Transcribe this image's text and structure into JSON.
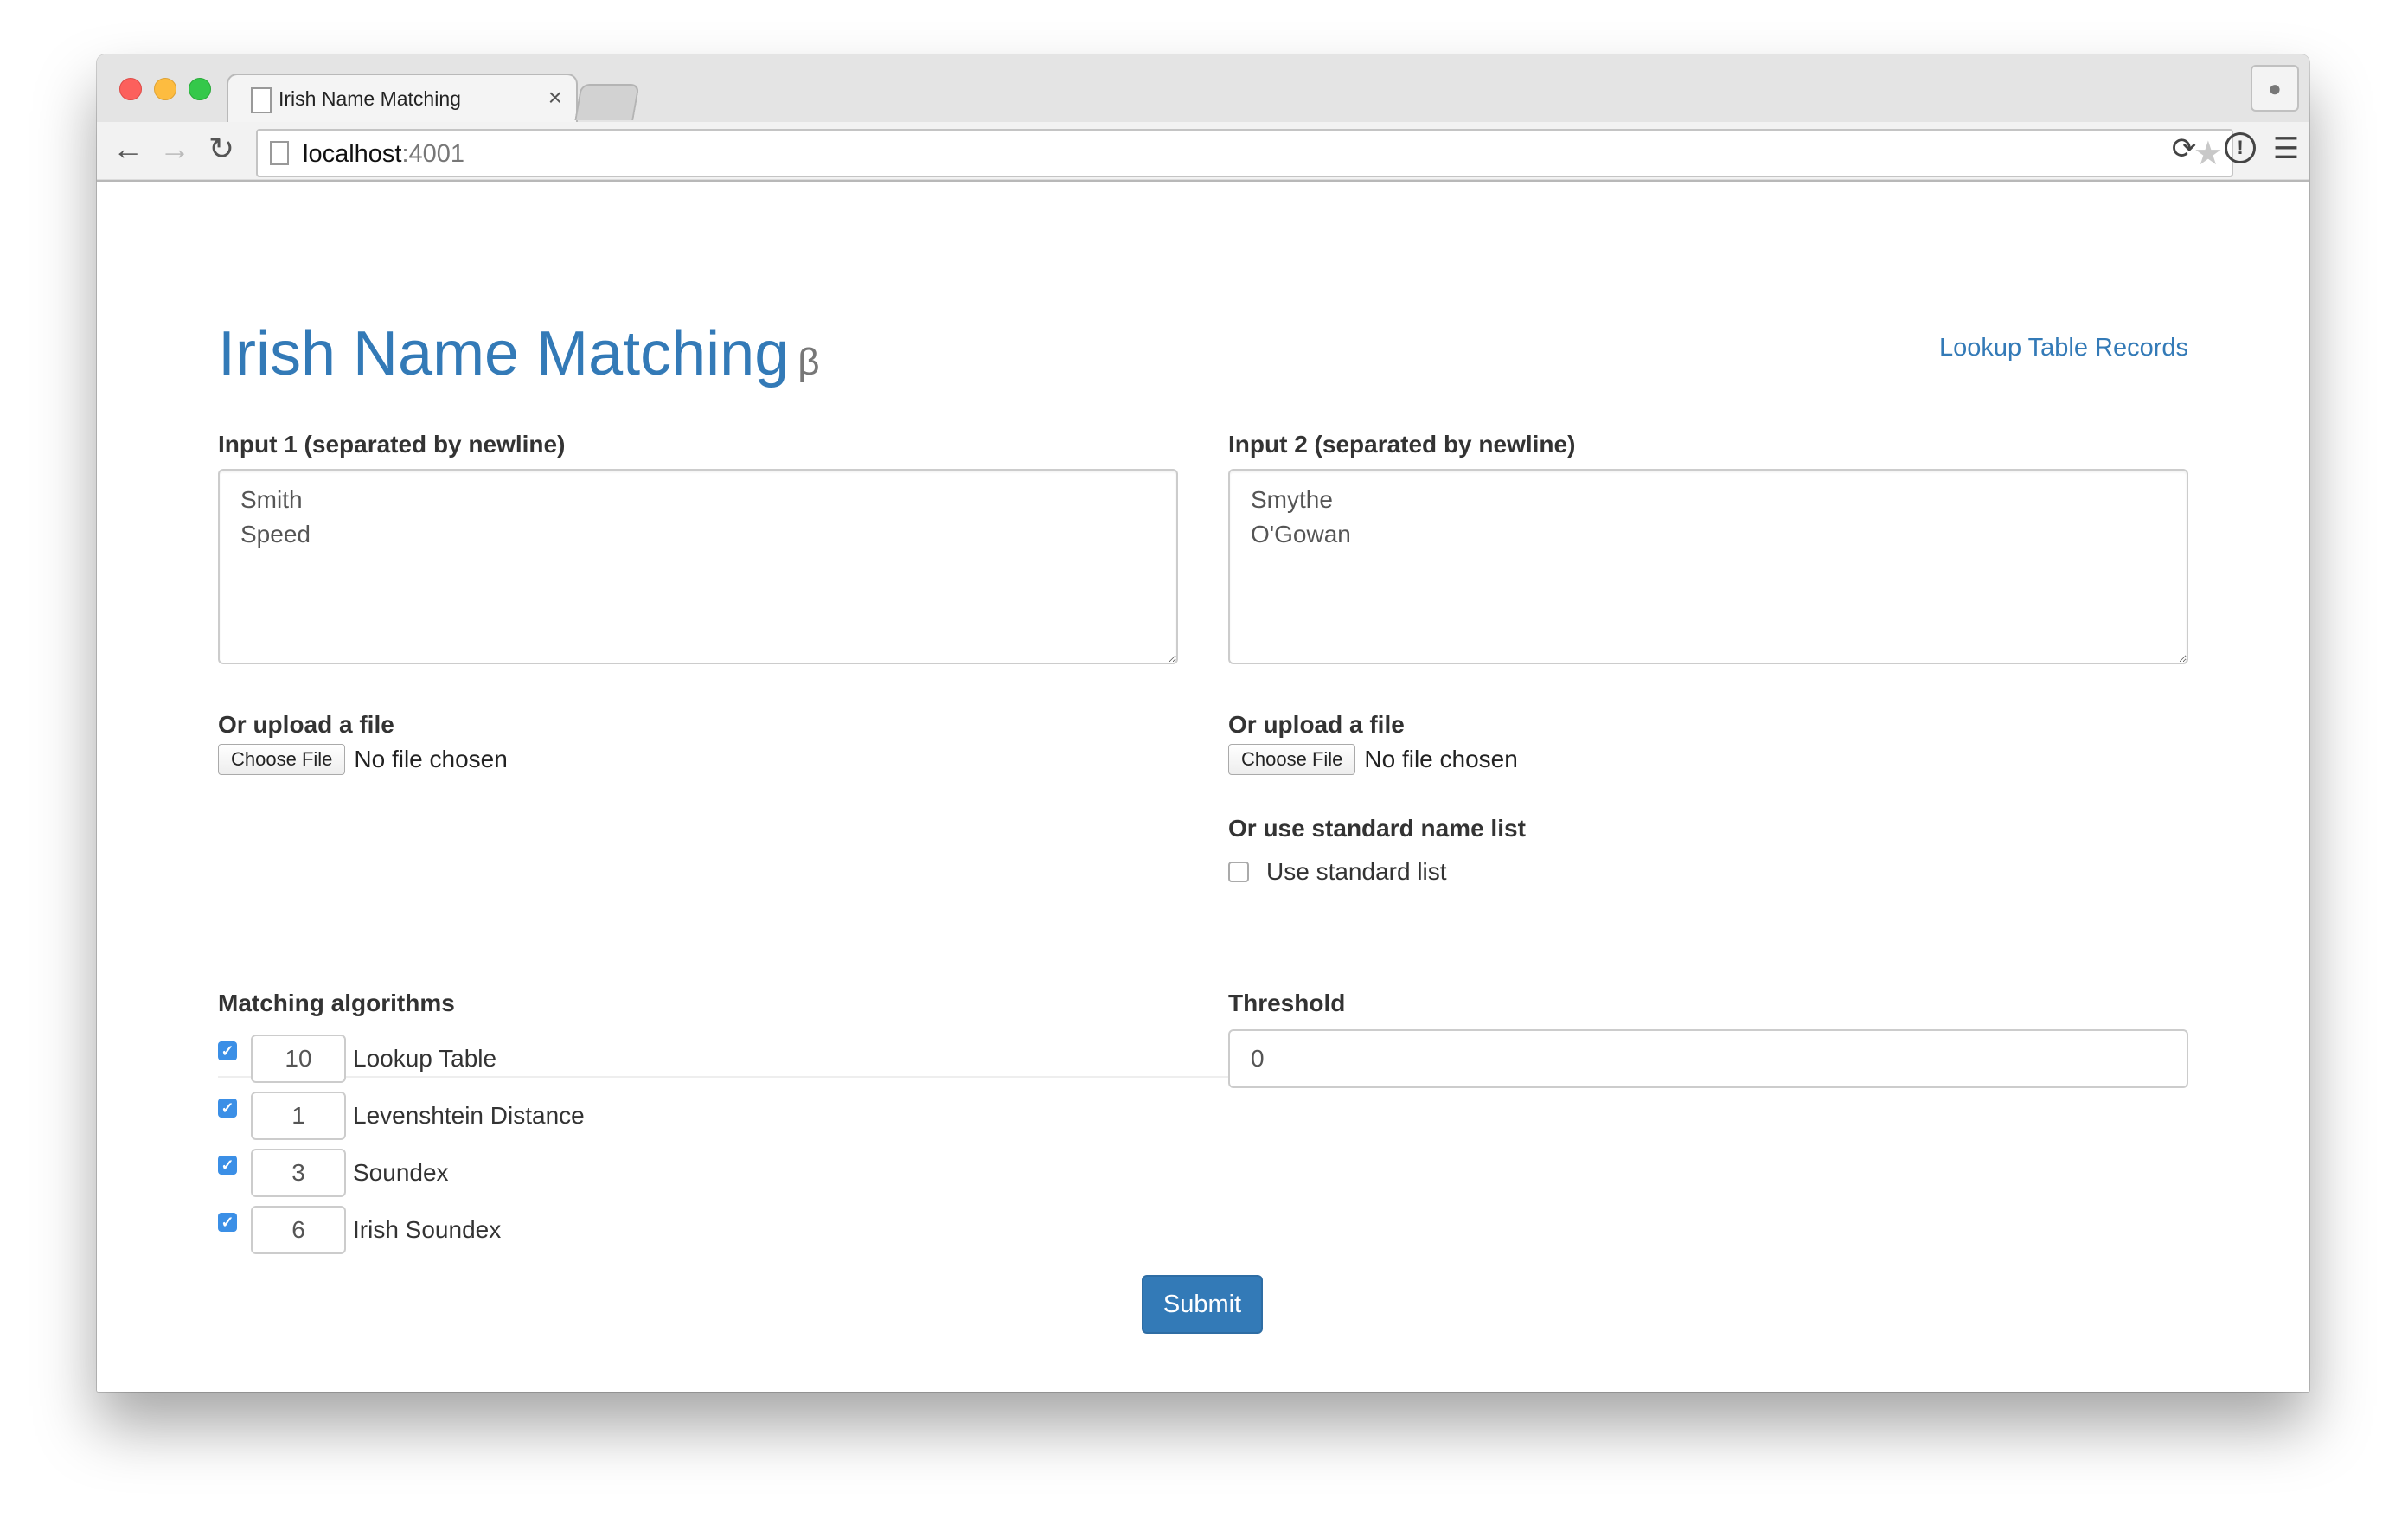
{
  "browser": {
    "tab_title": "Irish Name Matching",
    "tab_close": "×",
    "url_host": "localhost",
    "url_port": ":4001"
  },
  "page": {
    "title": "Irish Name Matching",
    "beta": "β",
    "lookup_link": "Lookup Table Records"
  },
  "input1": {
    "label": "Input 1 (separated by newline)",
    "value": "Smith\nSpeed",
    "upload_label": "Or upload a file",
    "choose_file": "Choose File",
    "no_file": "No file chosen"
  },
  "input2": {
    "label": "Input 2 (separated by newline)",
    "value": "Smythe\nO'Gowan",
    "upload_label": "Or upload a file",
    "choose_file": "Choose File",
    "no_file": "No file chosen",
    "standard_label": "Or use standard name list",
    "standard_checkbox": "Use standard list"
  },
  "algorithms": {
    "label": "Matching algorithms",
    "items": [
      {
        "weight": "10",
        "name": "Lookup Table",
        "checked": true
      },
      {
        "weight": "1",
        "name": "Levenshtein Distance",
        "checked": true
      },
      {
        "weight": "3",
        "name": "Soundex",
        "checked": true
      },
      {
        "weight": "6",
        "name": "Irish Soundex",
        "checked": true
      }
    ]
  },
  "threshold": {
    "label": "Threshold",
    "value": "0"
  },
  "submit_label": "Submit",
  "colors": {
    "link": "#337ab7",
    "primary_button": "#337ab7",
    "checkbox": "#3b8fe6"
  }
}
